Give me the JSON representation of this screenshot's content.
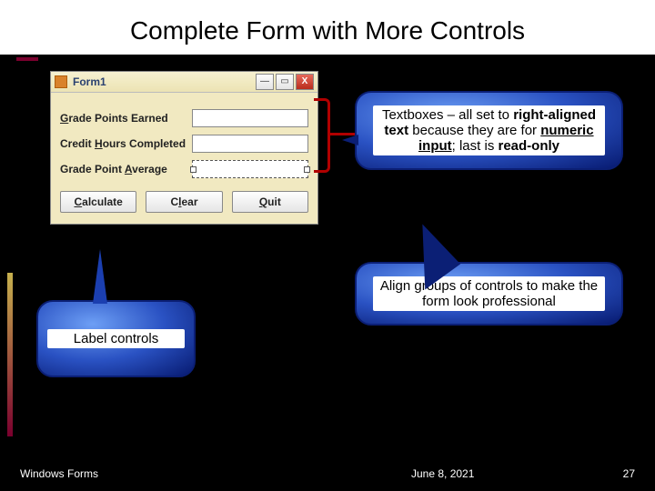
{
  "title": "Complete Form with More Controls",
  "window": {
    "title": "Form1",
    "labels": {
      "grade_points": "Grade Points Earned",
      "credit_hours": "Credit Hours Completed",
      "gpa": "Grade Point Average"
    },
    "buttons": {
      "calculate": "Calculate",
      "clear": "Clear",
      "quit": "Quit"
    }
  },
  "callouts": {
    "textboxes_prefix": "Textboxes – all set to ",
    "textboxes_b1": "right-aligned text",
    "textboxes_mid": " because they are for ",
    "textboxes_b2": "numeric input",
    "textboxes_mid2": "; last is ",
    "textboxes_b3": "read-only",
    "align": "Align groups of controls to make the form look professional",
    "labels": "Label controls"
  },
  "footer": {
    "left": "Windows Forms",
    "date": "June 8, 2021",
    "page": "27"
  }
}
